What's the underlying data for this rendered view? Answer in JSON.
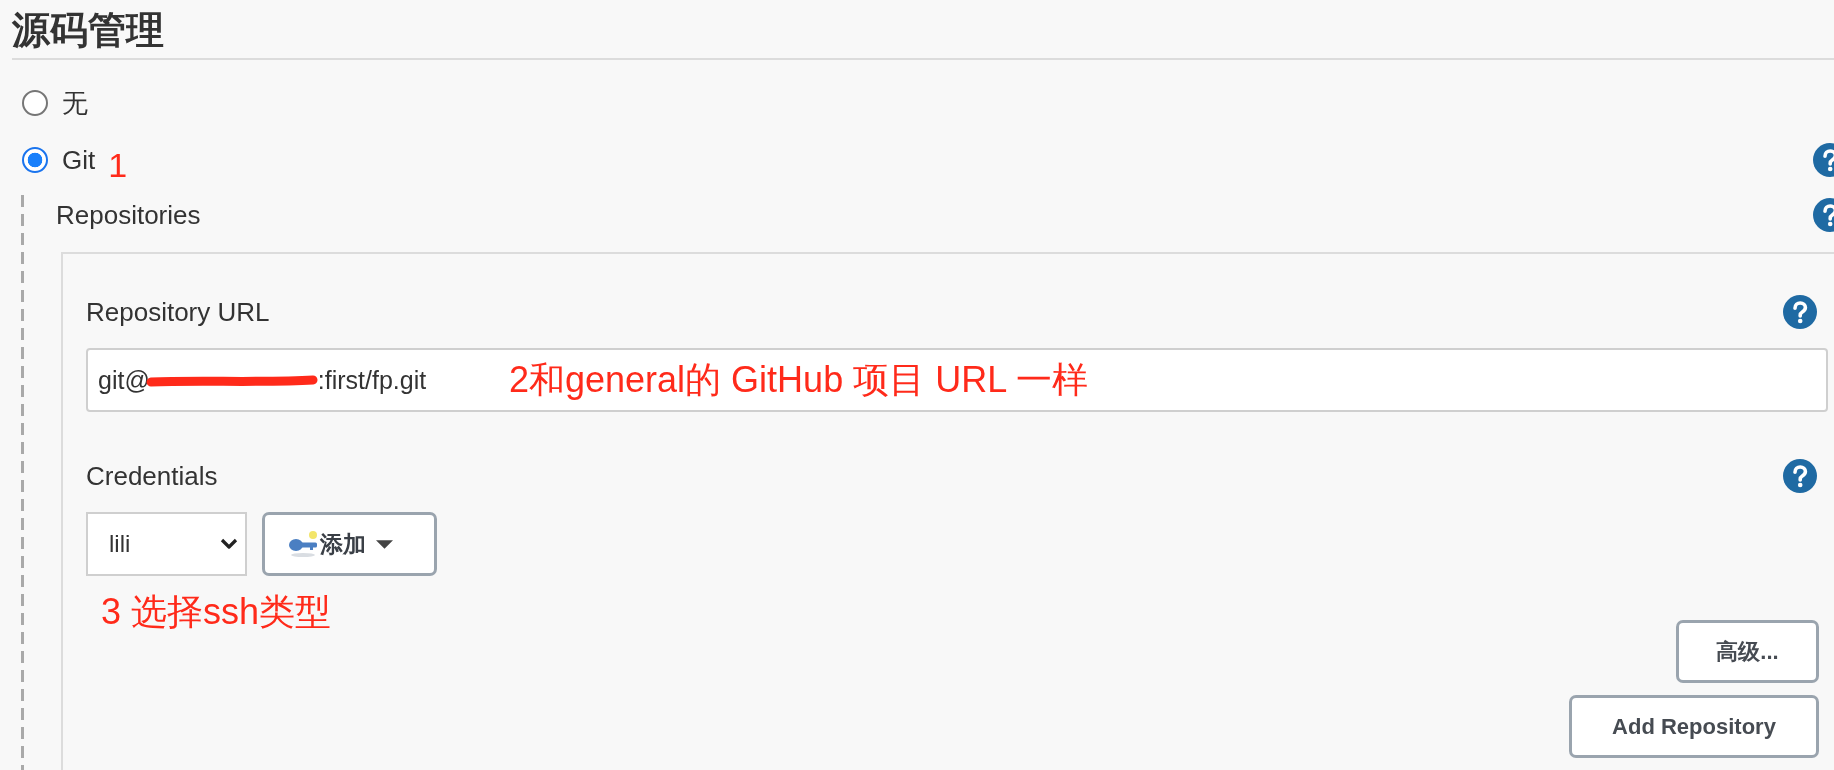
{
  "section": {
    "title": "源码管理"
  },
  "scm_options": [
    {
      "label": "无",
      "selected": false
    },
    {
      "label": "Git",
      "selected": true,
      "annotation": "1",
      "help": true
    }
  ],
  "repositories": {
    "label": "Repositories",
    "help": true
  },
  "repository_url": {
    "label": "Repository URL",
    "help": true,
    "value_start": "git@",
    "redacted": true,
    "value_end": ":first/fp.git",
    "annotation": "2和general的 GitHub 项目 URL 一样"
  },
  "credentials": {
    "label": "Credentials",
    "help": true,
    "selected_value": "lili",
    "add_button": "添加",
    "annotation": "3 选择ssh类型"
  },
  "buttons": [
    "高级...",
    "Add Repository"
  ]
}
